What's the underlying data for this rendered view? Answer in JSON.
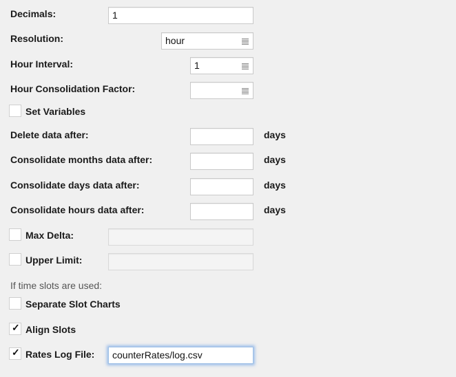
{
  "fields": {
    "decimals": {
      "label": "Decimals:",
      "value": "1"
    },
    "resolution": {
      "label": "Resolution:",
      "value": "hour"
    },
    "hour_interval": {
      "label": "Hour Interval:",
      "value": "1"
    },
    "hour_consolidation_factor": {
      "label": "Hour Consolidation Factor:",
      "value": ""
    },
    "set_variables": {
      "label": "Set Variables",
      "checked": false
    },
    "delete_data_after": {
      "label": "Delete data after:",
      "value": "",
      "unit": "days"
    },
    "consolidate_months": {
      "label": "Consolidate months data after:",
      "value": "",
      "unit": "days"
    },
    "consolidate_days": {
      "label": "Consolidate days data after:",
      "value": "",
      "unit": "days"
    },
    "consolidate_hours": {
      "label": "Consolidate hours data after:",
      "value": "",
      "unit": "days"
    },
    "max_delta": {
      "label": "Max Delta:",
      "checked": false,
      "value": ""
    },
    "upper_limit": {
      "label": "Upper Limit:",
      "checked": false,
      "value": ""
    },
    "time_slots_note": "If time slots are used:",
    "separate_slot_charts": {
      "label": "Separate Slot Charts",
      "checked": false
    },
    "align_slots": {
      "label": "Align Slots",
      "checked": true
    },
    "rates_log_file": {
      "label": "Rates Log File:",
      "checked": true,
      "value": "counterRates/log.csv"
    }
  },
  "icons": {
    "checkmark": "✓",
    "select": "select-lines-icon"
  }
}
